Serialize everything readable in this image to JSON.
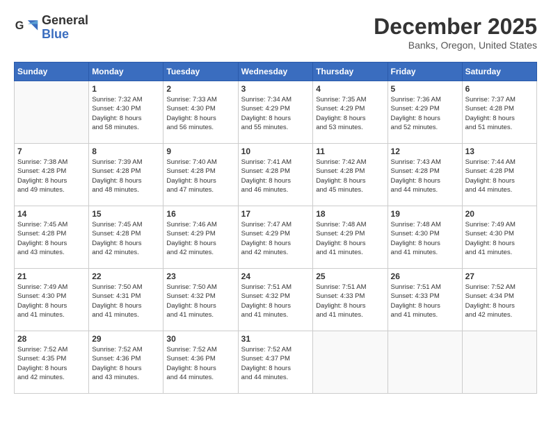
{
  "header": {
    "logo_line1": "General",
    "logo_line2": "Blue",
    "month": "December 2025",
    "location": "Banks, Oregon, United States"
  },
  "days_of_week": [
    "Sunday",
    "Monday",
    "Tuesday",
    "Wednesday",
    "Thursday",
    "Friday",
    "Saturday"
  ],
  "weeks": [
    [
      {
        "day": "",
        "info": ""
      },
      {
        "day": "1",
        "info": "Sunrise: 7:32 AM\nSunset: 4:30 PM\nDaylight: 8 hours\nand 58 minutes."
      },
      {
        "day": "2",
        "info": "Sunrise: 7:33 AM\nSunset: 4:30 PM\nDaylight: 8 hours\nand 56 minutes."
      },
      {
        "day": "3",
        "info": "Sunrise: 7:34 AM\nSunset: 4:29 PM\nDaylight: 8 hours\nand 55 minutes."
      },
      {
        "day": "4",
        "info": "Sunrise: 7:35 AM\nSunset: 4:29 PM\nDaylight: 8 hours\nand 53 minutes."
      },
      {
        "day": "5",
        "info": "Sunrise: 7:36 AM\nSunset: 4:29 PM\nDaylight: 8 hours\nand 52 minutes."
      },
      {
        "day": "6",
        "info": "Sunrise: 7:37 AM\nSunset: 4:28 PM\nDaylight: 8 hours\nand 51 minutes."
      }
    ],
    [
      {
        "day": "7",
        "info": "Sunrise: 7:38 AM\nSunset: 4:28 PM\nDaylight: 8 hours\nand 49 minutes."
      },
      {
        "day": "8",
        "info": "Sunrise: 7:39 AM\nSunset: 4:28 PM\nDaylight: 8 hours\nand 48 minutes."
      },
      {
        "day": "9",
        "info": "Sunrise: 7:40 AM\nSunset: 4:28 PM\nDaylight: 8 hours\nand 47 minutes."
      },
      {
        "day": "10",
        "info": "Sunrise: 7:41 AM\nSunset: 4:28 PM\nDaylight: 8 hours\nand 46 minutes."
      },
      {
        "day": "11",
        "info": "Sunrise: 7:42 AM\nSunset: 4:28 PM\nDaylight: 8 hours\nand 45 minutes."
      },
      {
        "day": "12",
        "info": "Sunrise: 7:43 AM\nSunset: 4:28 PM\nDaylight: 8 hours\nand 44 minutes."
      },
      {
        "day": "13",
        "info": "Sunrise: 7:44 AM\nSunset: 4:28 PM\nDaylight: 8 hours\nand 44 minutes."
      }
    ],
    [
      {
        "day": "14",
        "info": "Sunrise: 7:45 AM\nSunset: 4:28 PM\nDaylight: 8 hours\nand 43 minutes."
      },
      {
        "day": "15",
        "info": "Sunrise: 7:45 AM\nSunset: 4:28 PM\nDaylight: 8 hours\nand 42 minutes."
      },
      {
        "day": "16",
        "info": "Sunrise: 7:46 AM\nSunset: 4:29 PM\nDaylight: 8 hours\nand 42 minutes."
      },
      {
        "day": "17",
        "info": "Sunrise: 7:47 AM\nSunset: 4:29 PM\nDaylight: 8 hours\nand 42 minutes."
      },
      {
        "day": "18",
        "info": "Sunrise: 7:48 AM\nSunset: 4:29 PM\nDaylight: 8 hours\nand 41 minutes."
      },
      {
        "day": "19",
        "info": "Sunrise: 7:48 AM\nSunset: 4:30 PM\nDaylight: 8 hours\nand 41 minutes."
      },
      {
        "day": "20",
        "info": "Sunrise: 7:49 AM\nSunset: 4:30 PM\nDaylight: 8 hours\nand 41 minutes."
      }
    ],
    [
      {
        "day": "21",
        "info": "Sunrise: 7:49 AM\nSunset: 4:30 PM\nDaylight: 8 hours\nand 41 minutes."
      },
      {
        "day": "22",
        "info": "Sunrise: 7:50 AM\nSunset: 4:31 PM\nDaylight: 8 hours\nand 41 minutes."
      },
      {
        "day": "23",
        "info": "Sunrise: 7:50 AM\nSunset: 4:32 PM\nDaylight: 8 hours\nand 41 minutes."
      },
      {
        "day": "24",
        "info": "Sunrise: 7:51 AM\nSunset: 4:32 PM\nDaylight: 8 hours\nand 41 minutes."
      },
      {
        "day": "25",
        "info": "Sunrise: 7:51 AM\nSunset: 4:33 PM\nDaylight: 8 hours\nand 41 minutes."
      },
      {
        "day": "26",
        "info": "Sunrise: 7:51 AM\nSunset: 4:33 PM\nDaylight: 8 hours\nand 41 minutes."
      },
      {
        "day": "27",
        "info": "Sunrise: 7:52 AM\nSunset: 4:34 PM\nDaylight: 8 hours\nand 42 minutes."
      }
    ],
    [
      {
        "day": "28",
        "info": "Sunrise: 7:52 AM\nSunset: 4:35 PM\nDaylight: 8 hours\nand 42 minutes."
      },
      {
        "day": "29",
        "info": "Sunrise: 7:52 AM\nSunset: 4:36 PM\nDaylight: 8 hours\nand 43 minutes."
      },
      {
        "day": "30",
        "info": "Sunrise: 7:52 AM\nSunset: 4:36 PM\nDaylight: 8 hours\nand 44 minutes."
      },
      {
        "day": "31",
        "info": "Sunrise: 7:52 AM\nSunset: 4:37 PM\nDaylight: 8 hours\nand 44 minutes."
      },
      {
        "day": "",
        "info": ""
      },
      {
        "day": "",
        "info": ""
      },
      {
        "day": "",
        "info": ""
      }
    ]
  ]
}
